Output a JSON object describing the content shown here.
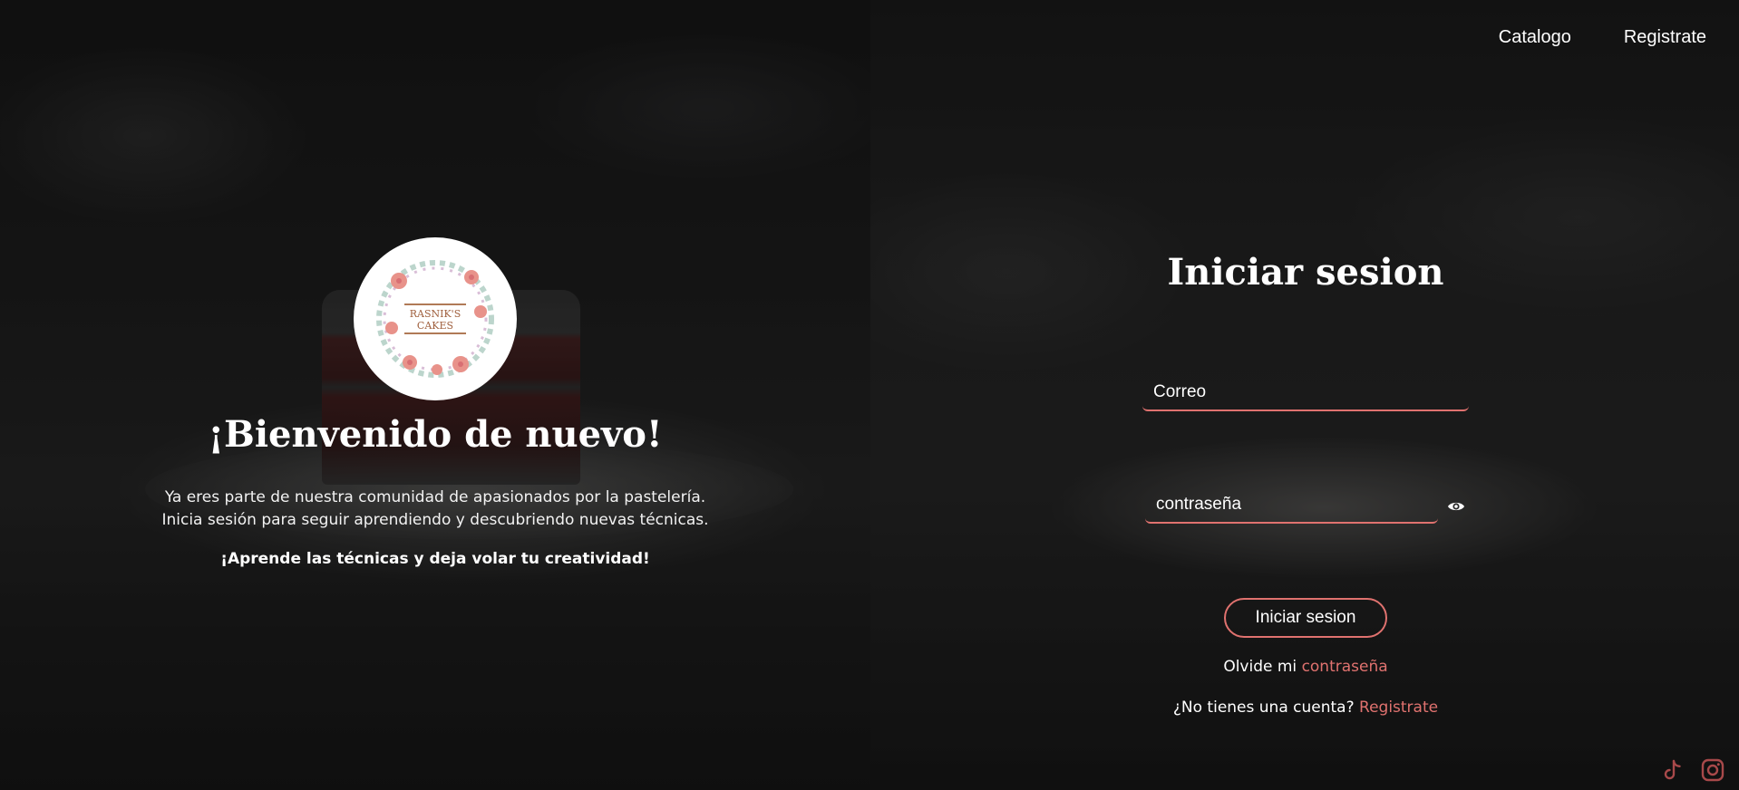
{
  "nav": {
    "catalog": "Catalogo",
    "register": "Registrate"
  },
  "welcome": {
    "title": "¡Bienvenido de nuevo!",
    "line1": "Ya eres parte de nuestra comunidad de apasionados por la pastelería.",
    "line2": "Inicia sesión para seguir aprendiendo y descubriendo nuevas técnicas.",
    "cta": "¡Aprende las técnicas y deja volar tu creatividad!"
  },
  "logo": {
    "line1": "RASNIK'S",
    "line2": "CAKES"
  },
  "login": {
    "title": "Iniciar sesion",
    "email_placeholder": "Correo",
    "password_placeholder": "contraseña",
    "submit": "Iniciar sesion",
    "forgot_prefix": "Olvide mi",
    "forgot_link": "contraseña",
    "signup_prefix": "¿No tienes una cuenta?",
    "signup_link": "Registrate"
  },
  "social": {
    "icons": [
      "tiktok-icon",
      "instagram-icon"
    ]
  },
  "colors": {
    "accent": "#e0726f",
    "text": "#ffffff"
  }
}
